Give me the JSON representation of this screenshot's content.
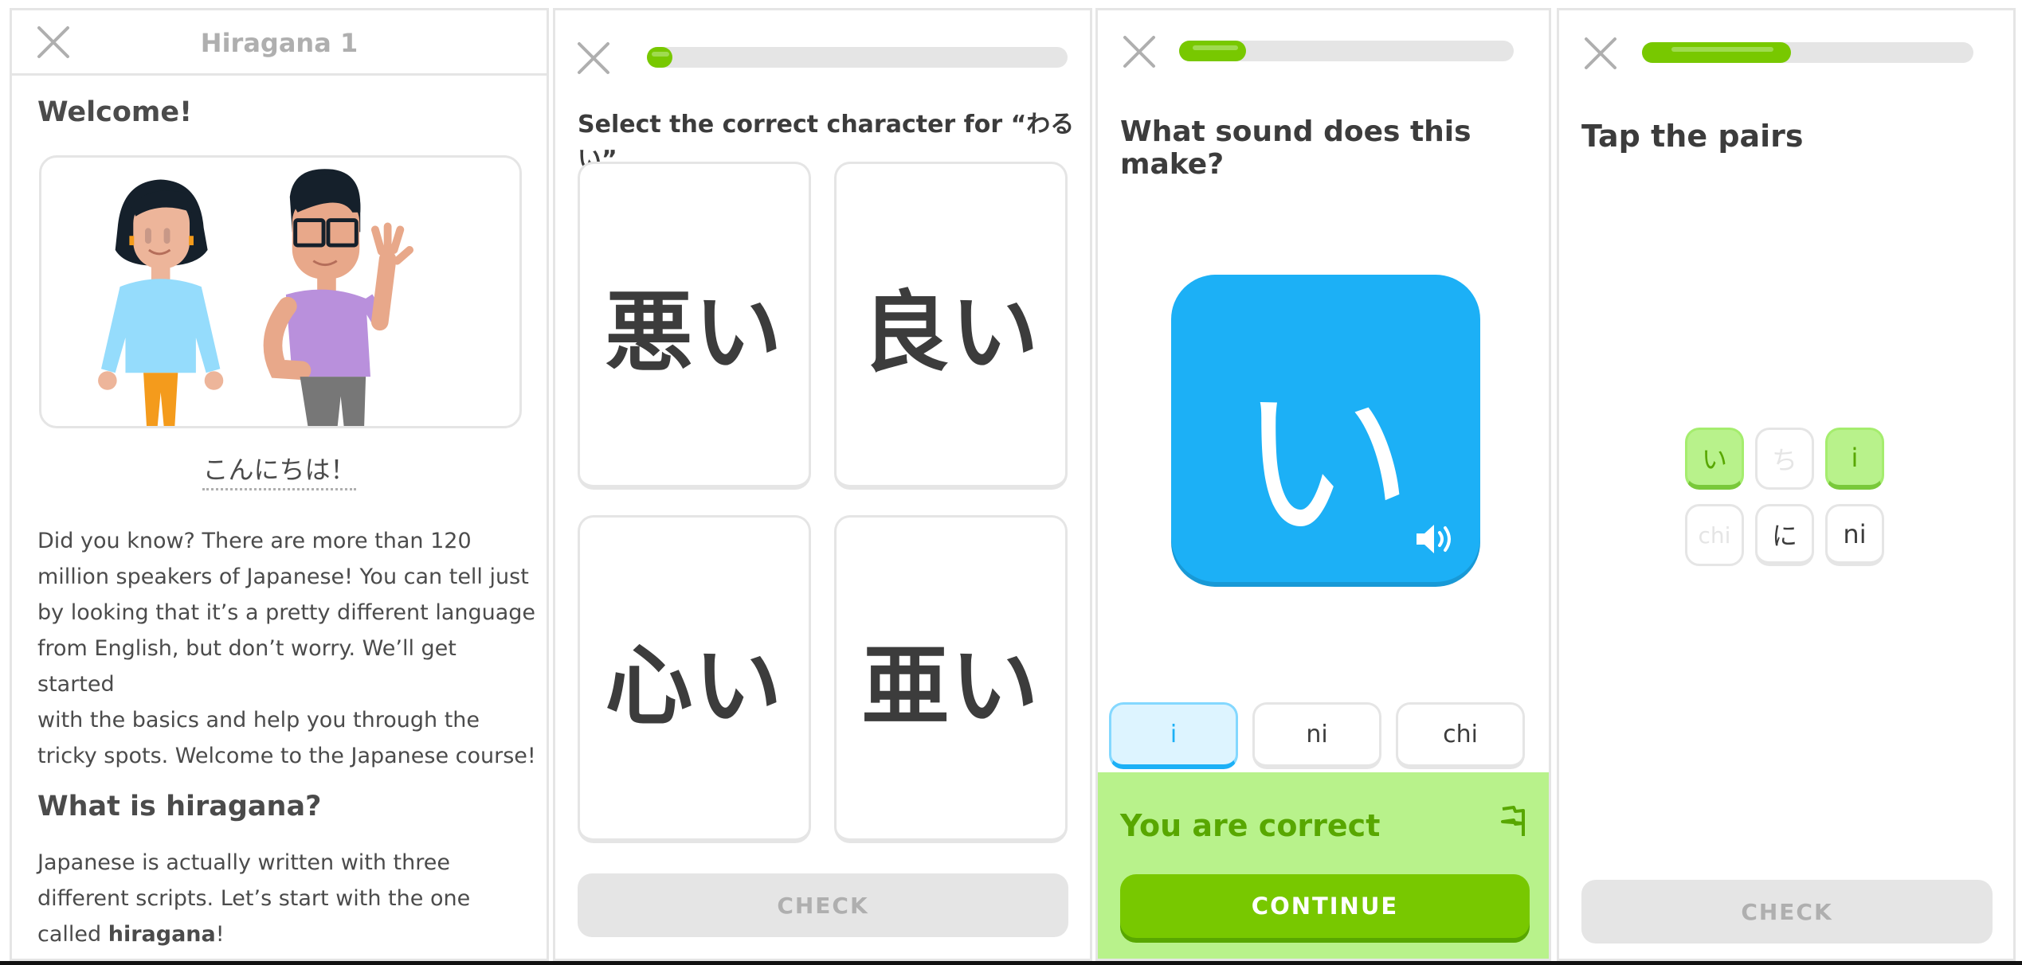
{
  "colors": {
    "brand_green": "#78c800",
    "correct_bg": "#b8f28b",
    "correct_text": "#58a700",
    "blue": "#1cb0f6",
    "selected_bg": "#ddf4ff",
    "disabled": "#e5e5e5",
    "text": "#4b4b4b"
  },
  "panel1": {
    "close_icon": "close-icon",
    "title": "Hiragana 1",
    "welcome_heading": "Welcome!",
    "illustration": "two-characters-waving",
    "greeting": "こんにちは！",
    "intro_lines": [
      "Did you know? There are more than 120",
      "million speakers of Japanese! You can tell just",
      "by looking that it’s a pretty different language",
      "from English, but don’t worry. We’ll get started",
      "with the basics and help you through the",
      "tricky spots. Welcome to the Japanese course!"
    ],
    "section_heading": "What is hiragana?",
    "section_lines": [
      "Japanese is actually written with three",
      "different scripts. Let’s start with the one"
    ],
    "section_last_prefix": "called ",
    "section_last_bold": "hiragana",
    "section_last_suffix": "!"
  },
  "panel2": {
    "progress": 0.06,
    "question": "Select the correct character for “わるい”",
    "choices": [
      "悪い",
      "良い",
      "心い",
      "亜い"
    ],
    "check_label": "CHECK"
  },
  "panel3": {
    "progress": 0.2,
    "question": "What sound does this make?",
    "character": "い",
    "speaker_icon": "speaker-icon",
    "options": [
      {
        "label": "i",
        "selected": true
      },
      {
        "label": "ni",
        "selected": false
      },
      {
        "label": "chi",
        "selected": false
      }
    ],
    "feedback": "You are correct",
    "continue_label": "CONTINUE"
  },
  "panel4": {
    "progress": 0.45,
    "title": "Tap the pairs",
    "tiles": [
      {
        "label": "い",
        "state": "matched"
      },
      {
        "label": "ち",
        "state": "disabled"
      },
      {
        "label": "i",
        "state": "matched"
      },
      {
        "label": "chi",
        "state": "disabled"
      },
      {
        "label": "に",
        "state": "normal"
      },
      {
        "label": "ni",
        "state": "normal"
      }
    ],
    "check_label": "CHECK"
  }
}
